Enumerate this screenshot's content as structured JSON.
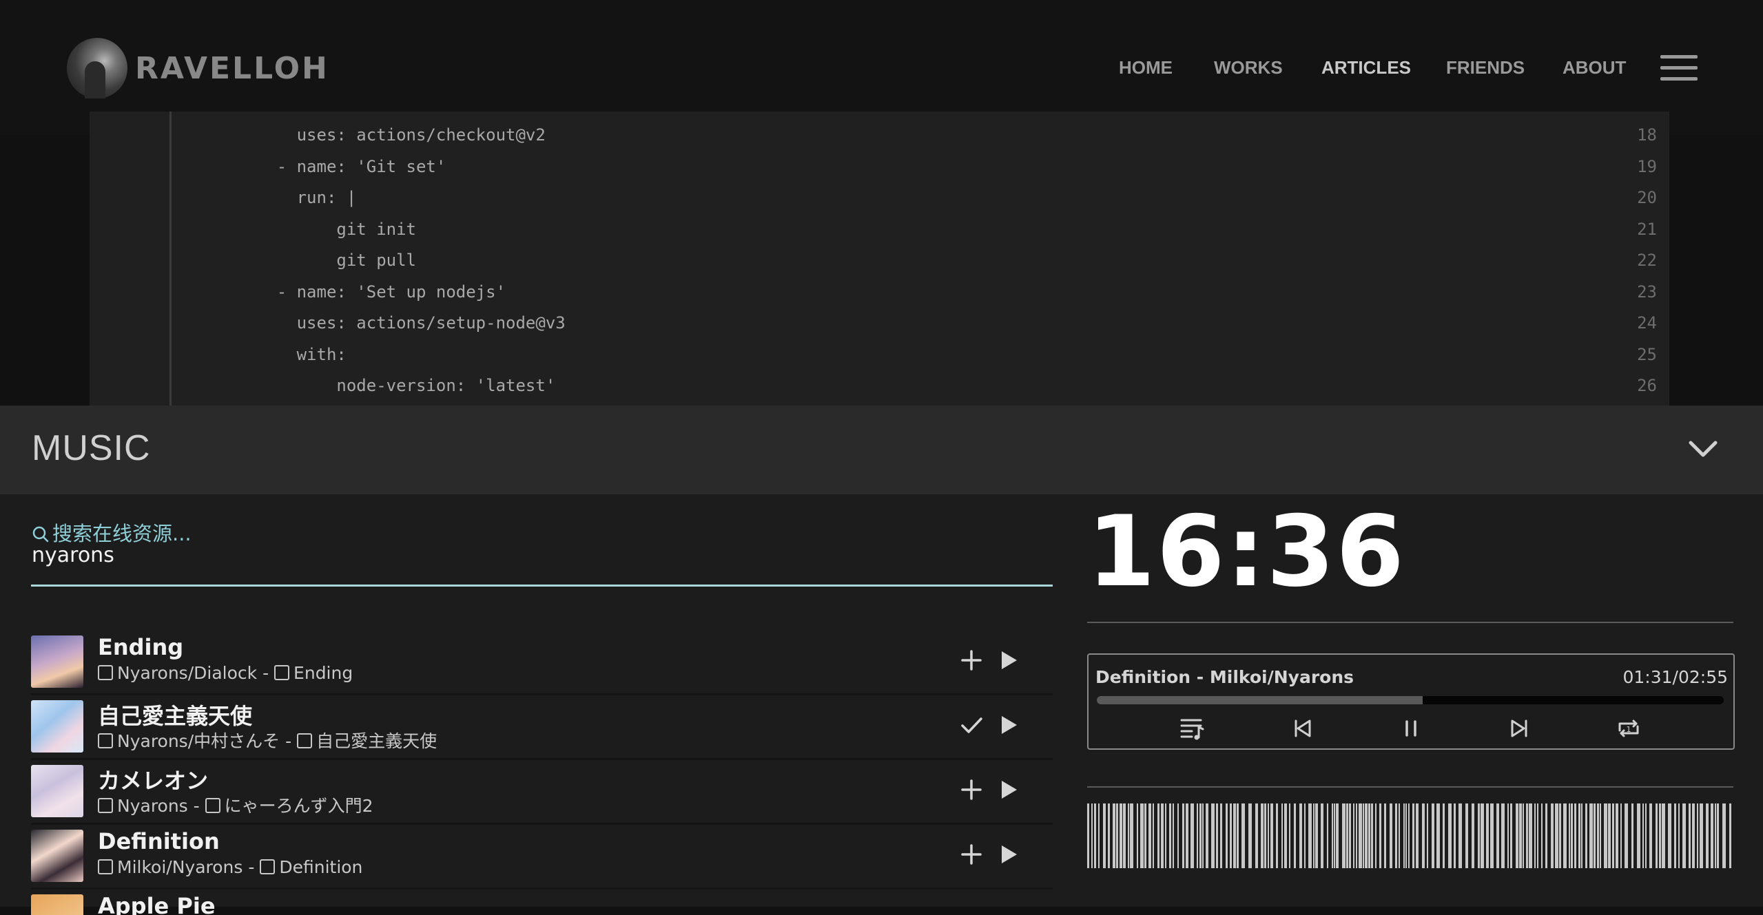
{
  "header": {
    "logo_text": "RAVELLOH",
    "nav": [
      "HOME",
      "WORKS",
      "ARTICLES",
      "FRIENDS",
      "ABOUT"
    ],
    "active_nav": "ARTICLES"
  },
  "code": {
    "lines": [
      {
        "n": "18",
        "text": "        uses: actions/checkout@v2"
      },
      {
        "n": "19",
        "text": "      - name: 'Git set'"
      },
      {
        "n": "20",
        "text": "        run: |"
      },
      {
        "n": "21",
        "text": "            git init"
      },
      {
        "n": "22",
        "text": "            git pull"
      },
      {
        "n": "23",
        "text": "      - name: 'Set up nodejs'"
      },
      {
        "n": "24",
        "text": "        uses: actions/setup-node@v3"
      },
      {
        "n": "25",
        "text": "        with:"
      },
      {
        "n": "26",
        "text": "            node-version: 'latest'"
      }
    ]
  },
  "music": {
    "title": "MUSIC",
    "search_label": "搜索在线资源...",
    "search_value": "nyarons",
    "results": [
      {
        "title": "Ending",
        "artist": "Nyarons/Dialock",
        "album": "Ending",
        "added": false
      },
      {
        "title": "自己愛主義天使",
        "artist": "Nyarons/中村さんそ",
        "album": "自己愛主義天使",
        "added": true
      },
      {
        "title": "カメレオン",
        "artist": "Nyarons",
        "album": "にゃーろんず入門2",
        "added": false
      },
      {
        "title": "Definition",
        "artist": "Milkoi/Nyarons",
        "album": "Definition",
        "added": false
      },
      {
        "title": "Apple Pie",
        "artist": "",
        "album": "",
        "added": false
      }
    ],
    "separator": " - "
  },
  "clock": "16:36",
  "player": {
    "now_playing": "Definition - Milkoi/Nyarons",
    "time": "01:31/02:55",
    "progress": 0.52
  },
  "colors": {
    "accent": "#a8d8dc",
    "background": "#111111",
    "panel": "#1c1c1c"
  }
}
